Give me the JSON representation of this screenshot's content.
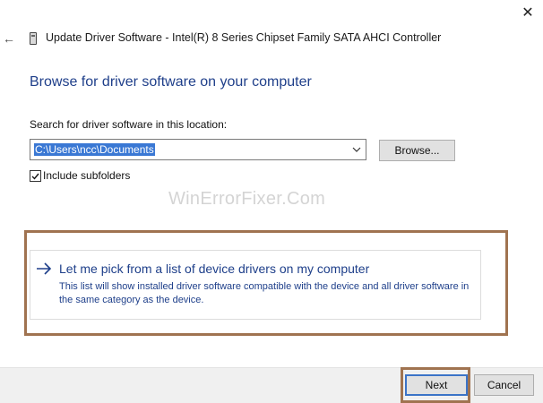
{
  "window": {
    "title": "Update Driver Software - Intel(R) 8 Series Chipset Family SATA AHCI Controller",
    "close_glyph": "✕",
    "back_glyph": "←"
  },
  "heading": "Browse for driver software on your computer",
  "search": {
    "label": "Search for driver software in this location:",
    "path_value": "C:\\Users\\ncc\\Documents",
    "browse_label": "Browse..."
  },
  "include_subfolders": {
    "label": "Include subfolders",
    "checked": true
  },
  "watermark": "WinErrorFixer.Com",
  "pick_option": {
    "title": "Let me pick from a list of device drivers on my computer",
    "description": "This list will show installed driver software compatible with the device and all driver software in the same category as the device."
  },
  "footer": {
    "next_label": "Next",
    "cancel_label": "Cancel"
  },
  "colors": {
    "heading_blue": "#1f3f8a",
    "link_blue": "#1e3f8a",
    "highlight_brown": "#a07350",
    "selection_blue": "#3a78d4"
  }
}
